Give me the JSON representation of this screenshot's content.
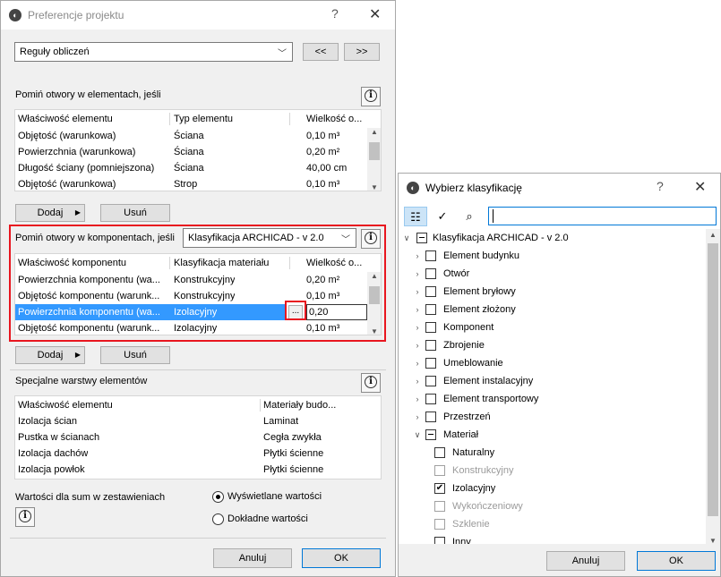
{
  "win1": {
    "title": "Preferencje projektu",
    "help": "?",
    "close": "✕",
    "top_combo": "Reguły obliczeń",
    "prev_btn": "<<",
    "next_btn": ">>",
    "sec1": {
      "title": "Pomiń otwory w elementach, jeśli",
      "headers": [
        "Właściwość elementu",
        "Typ elementu",
        "Wielkość o..."
      ],
      "rows": [
        [
          "Objętość (warunkowa)",
          "Ściana",
          "0,10 m³"
        ],
        [
          "Powierzchnia (warunkowa)",
          "Ściana",
          "0,20 m²"
        ],
        [
          "Długość ściany (pomniejszona)",
          "Ściana",
          "40,00 cm"
        ],
        [
          "Objętość (warunkowa)",
          "Strop",
          "0,10 m³"
        ]
      ],
      "add": "Dodaj",
      "remove": "Usuń"
    },
    "sec2": {
      "title": "Pomiń otwory w komponentach, jeśli",
      "combo": "Klasyfikacja ARCHICAD - v 2.0",
      "headers": [
        "Właściwość komponentu",
        "Klasyfikacja materiału",
        "Wielkość o..."
      ],
      "rows": [
        [
          "Powierzchnia komponentu (wa...",
          "Konstrukcyjny",
          "0,20 m²"
        ],
        [
          "Objętość komponentu (warunk...",
          "Konstrukcyjny",
          "0,10 m³"
        ],
        [
          "Powierzchnia komponentu (wa...",
          "Izolacyjny",
          "0,20"
        ],
        [
          "Objętość komponentu (warunk...",
          "Izolacyjny",
          "0,10 m³"
        ]
      ],
      "browse": "...",
      "add": "Dodaj",
      "remove": "Usuń"
    },
    "sec3": {
      "title": "Specjalne warstwy elementów",
      "headers": [
        "Właściwość elementu",
        "Materiały budo..."
      ],
      "rows": [
        [
          "Izolacja ścian",
          "Laminat"
        ],
        [
          "Pustka w ścianach",
          "Cegła zwykła"
        ],
        [
          "Izolacja dachów",
          "Płytki ścienne"
        ],
        [
          "Izolacja powłok",
          "Płytki ścienne"
        ]
      ]
    },
    "sums": {
      "label": "Wartości dla sum w zestawieniach",
      "opt1": "Wyświetlane wartości",
      "opt2": "Dokładne wartości"
    },
    "cancel": "Anuluj",
    "ok": "OK"
  },
  "win2": {
    "title": "Wybierz klasyfikację",
    "help": "?",
    "close": "✕",
    "search_value": "",
    "root": "Klasyfikacja ARCHICAD - v 2.0",
    "items": [
      {
        "label": "Element budynku"
      },
      {
        "label": "Otwór"
      },
      {
        "label": "Element bryłowy"
      },
      {
        "label": "Element złożony"
      },
      {
        "label": "Komponent"
      },
      {
        "label": "Zbrojenie"
      },
      {
        "label": "Umeblowanie"
      },
      {
        "label": "Element instalacyjny"
      },
      {
        "label": "Element transportowy"
      },
      {
        "label": "Przestrzeń"
      },
      {
        "label": "Materiał"
      }
    ],
    "children": [
      {
        "label": "Naturalny"
      },
      {
        "label": "Konstrukcyjny"
      },
      {
        "label": "Izolacyjny"
      },
      {
        "label": "Wykończeniowy"
      },
      {
        "label": "Szklenie"
      },
      {
        "label": "Inny"
      }
    ],
    "cancel": "Anuluj",
    "ok": "OK"
  }
}
